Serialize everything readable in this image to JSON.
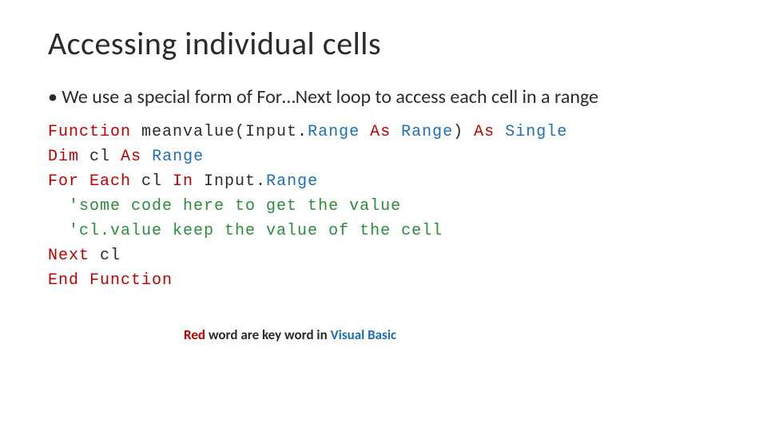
{
  "title": "Accessing individual cells",
  "bullet": "We use a special form of For…Next loop to access each cell in a range",
  "code": {
    "l1": {
      "kw1": "Function",
      "id1": " meanvalue(Input.",
      "typ1": "Range",
      "id2": " ",
      "kw2": "As",
      "id3": " ",
      "typ2": "Range",
      "id4": ") ",
      "kw3": "As",
      "id5": " ",
      "typ3": "Single"
    },
    "l2": {
      "kw1": "Dim",
      "id1": " cl ",
      "kw2": "As",
      "id2": " ",
      "typ1": "Range"
    },
    "l3": {
      "kw1": "For Each",
      "id1": " cl ",
      "kw2": "In",
      "id2": " Input.",
      "typ1": "Range"
    },
    "l4": {
      "pad": "  ",
      "com": "'some code here to get the value"
    },
    "l5": {
      "pad": "  ",
      "com": "'cl.value keep the value of the cell"
    },
    "l6": {
      "kw1": "Next",
      "id1": " cl"
    },
    "l7": {
      "kw1": "End Function"
    }
  },
  "footnote": {
    "red": "Red",
    "mid": " word are key word in ",
    "blue": "Visual Basic"
  }
}
